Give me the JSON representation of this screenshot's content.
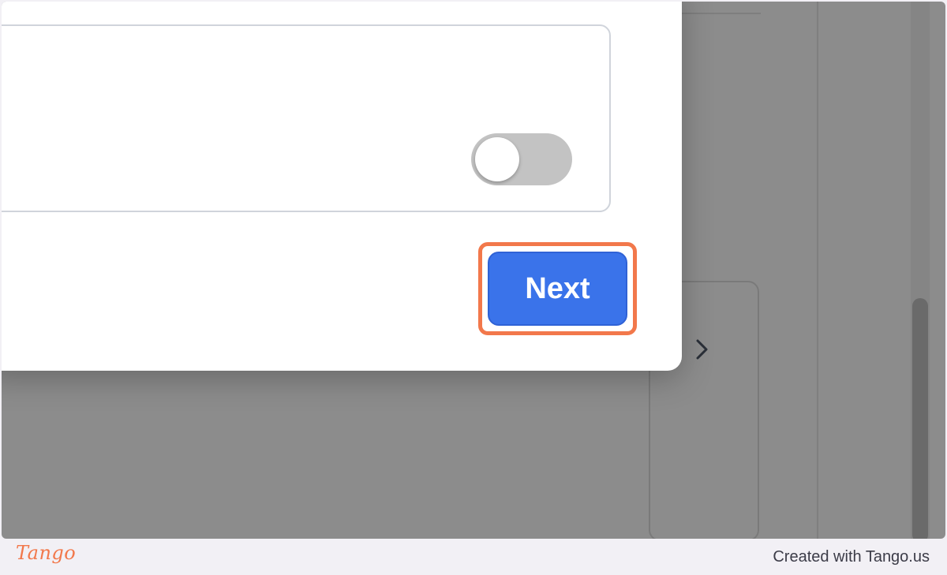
{
  "modal": {
    "toggle_state": "off",
    "next_button_label": "Next"
  },
  "footer": {
    "logo_text": "Tango",
    "credit_text": "Created with Tango.us"
  },
  "icons": {
    "background_chevron": "chevron-right-icon"
  },
  "colors": {
    "primary_button": "#3a73ea",
    "highlight_ring": "#f2784b",
    "overlay": "#8c8c8c",
    "toggle_off": "#c3c3c3"
  }
}
